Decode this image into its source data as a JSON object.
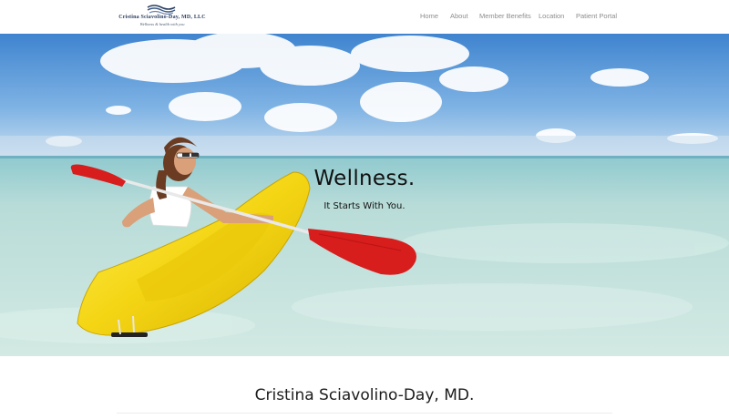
{
  "brand": {
    "name": "Cristina Sciavolino-Day, MD, LLC",
    "tagline": "Wellness & health with you"
  },
  "nav": {
    "items": [
      {
        "label": "Home"
      },
      {
        "label": "About"
      },
      {
        "label": "Member Benefits"
      },
      {
        "label": "Location"
      },
      {
        "label": "Patient Portal"
      }
    ]
  },
  "hero": {
    "title": "Wellness.",
    "subtitle": "It Starts With You.",
    "image": "woman-kayaking-in-shallow-sea"
  },
  "intro": {
    "heading": "Cristina Sciavolino-Day, MD."
  },
  "colors": {
    "logo_navy": "#2b3f62",
    "nav_text": "#8d8d8d",
    "kayak_yellow": "#f4d514",
    "paddle_red": "#d81d1d",
    "sky_blue": "#5f9bd6",
    "water": "#bfdcd6"
  }
}
